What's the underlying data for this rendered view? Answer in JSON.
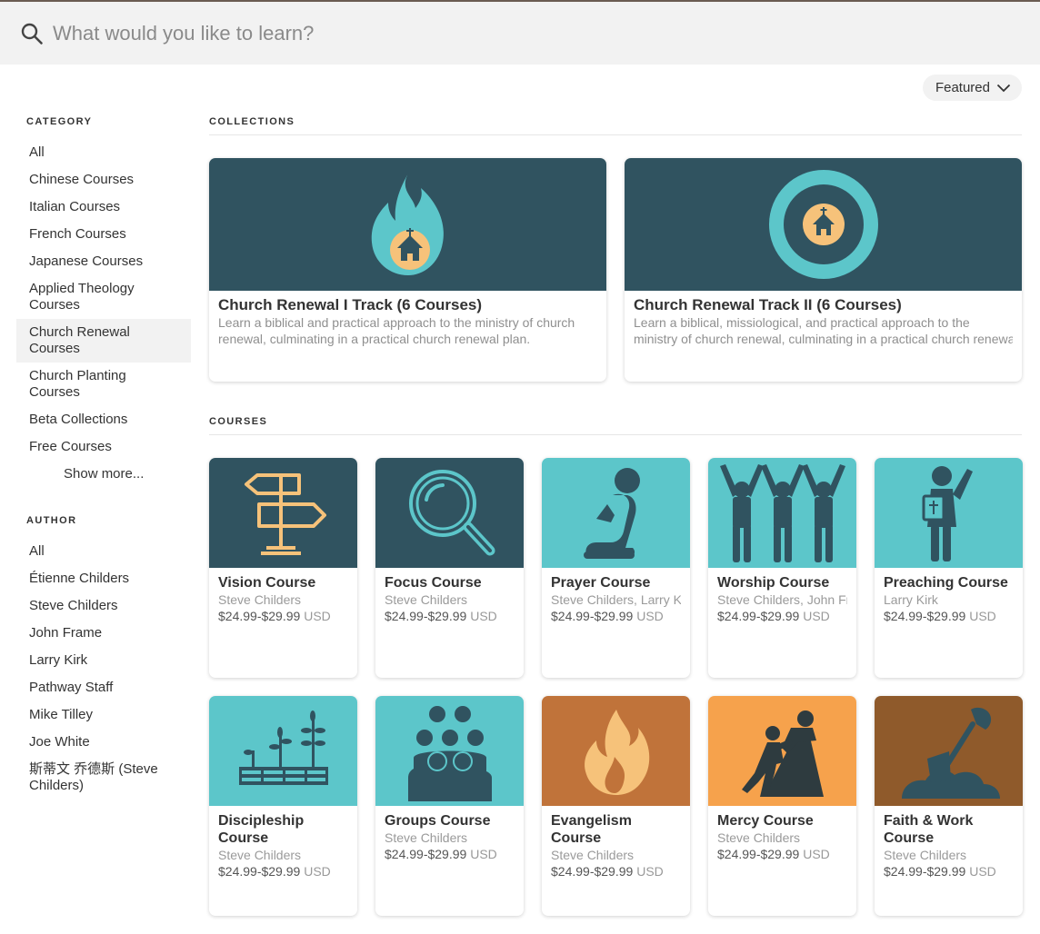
{
  "search": {
    "placeholder": "What would you like to learn?"
  },
  "sort": {
    "label": "Featured"
  },
  "sidebar": {
    "category_heading": "CATEGORY",
    "categories": [
      {
        "label": "All"
      },
      {
        "label": "Chinese Courses"
      },
      {
        "label": "Italian Courses"
      },
      {
        "label": "French Courses"
      },
      {
        "label": "Japanese Courses"
      },
      {
        "label": "Applied Theology Courses"
      },
      {
        "label": "Church Renewal Courses",
        "active": true
      },
      {
        "label": "Church Planting Courses"
      },
      {
        "label": "Beta Collections"
      },
      {
        "label": "Free Courses"
      }
    ],
    "show_more": "Show more...",
    "author_heading": "AUTHOR",
    "authors": [
      {
        "label": "All"
      },
      {
        "label": "Étienne Childers"
      },
      {
        "label": "Steve Childers"
      },
      {
        "label": "John Frame"
      },
      {
        "label": "Larry Kirk"
      },
      {
        "label": "Pathway Staff"
      },
      {
        "label": "Mike Tilley"
      },
      {
        "label": "Joe White"
      },
      {
        "label": "斯蒂文 乔德斯 (Steve Childers)"
      }
    ]
  },
  "collections": {
    "heading": "COLLECTIONS",
    "items": [
      {
        "title": "Church Renewal I Track (6 Courses)",
        "desc1": "Learn a biblical and practical approach to the ministry of church",
        "desc2": "renewal, culminating in a practical church renewal plan.",
        "icon": "flame-church-icon"
      },
      {
        "title": "Church Renewal Track II (6 Courses)",
        "desc1": "Learn a biblical, missiological, and practical approach to the",
        "desc2": "ministry of church renewal, culminating in a practical church renewal plan.",
        "icon": "target-church-icon"
      }
    ]
  },
  "courses": {
    "heading": "COURSES",
    "items": [
      {
        "title": "Vision Course",
        "author": "Steve Childers",
        "price": "$24.99-$29.99",
        "currency": "USD",
        "bg": "#305360",
        "icon": "signpost-icon"
      },
      {
        "title": "Focus Course",
        "author": "Steve Childers",
        "price": "$24.99-$29.99",
        "currency": "USD",
        "bg": "#305360",
        "icon": "magnifier-icon"
      },
      {
        "title": "Prayer Course",
        "author": "Steve Childers, Larry Kirk",
        "price": "$24.99-$29.99",
        "currency": "USD",
        "bg": "#5cc6ca",
        "icon": "praying-person-icon"
      },
      {
        "title": "Worship Course",
        "author": "Steve Childers, John Frame",
        "price": "$24.99-$29.99",
        "currency": "USD",
        "bg": "#5cc6ca",
        "icon": "raised-hands-icon"
      },
      {
        "title": "Preaching Course",
        "author": "Larry Kirk",
        "price": "$24.99-$29.99",
        "currency": "USD",
        "bg": "#5cc6ca",
        "icon": "preacher-icon"
      },
      {
        "title": "Discipleship Course",
        "author": "Steve Childers",
        "price": "$24.99-$29.99",
        "currency": "USD",
        "bg": "#5cc6ca",
        "icon": "growing-plants-icon"
      },
      {
        "title": "Groups Course",
        "author": "Steve Childers",
        "price": "$24.99-$29.99",
        "currency": "USD",
        "bg": "#5cc6ca",
        "icon": "people-group-icon"
      },
      {
        "title": "Evangelism Course",
        "author": "Steve Childers",
        "price": "$24.99-$29.99",
        "currency": "USD",
        "bg": "#c0733a",
        "icon": "fire-icon"
      },
      {
        "title": "Mercy Course",
        "author": "Steve Childers",
        "price": "$24.99-$29.99",
        "currency": "USD",
        "bg": "#f6a24c",
        "icon": "helping-climb-icon"
      },
      {
        "title": "Faith & Work Course",
        "author": "Steve Childers",
        "price": "$24.99-$29.99",
        "currency": "USD",
        "bg": "#8f5a2b",
        "icon": "shovel-icon"
      }
    ]
  }
}
